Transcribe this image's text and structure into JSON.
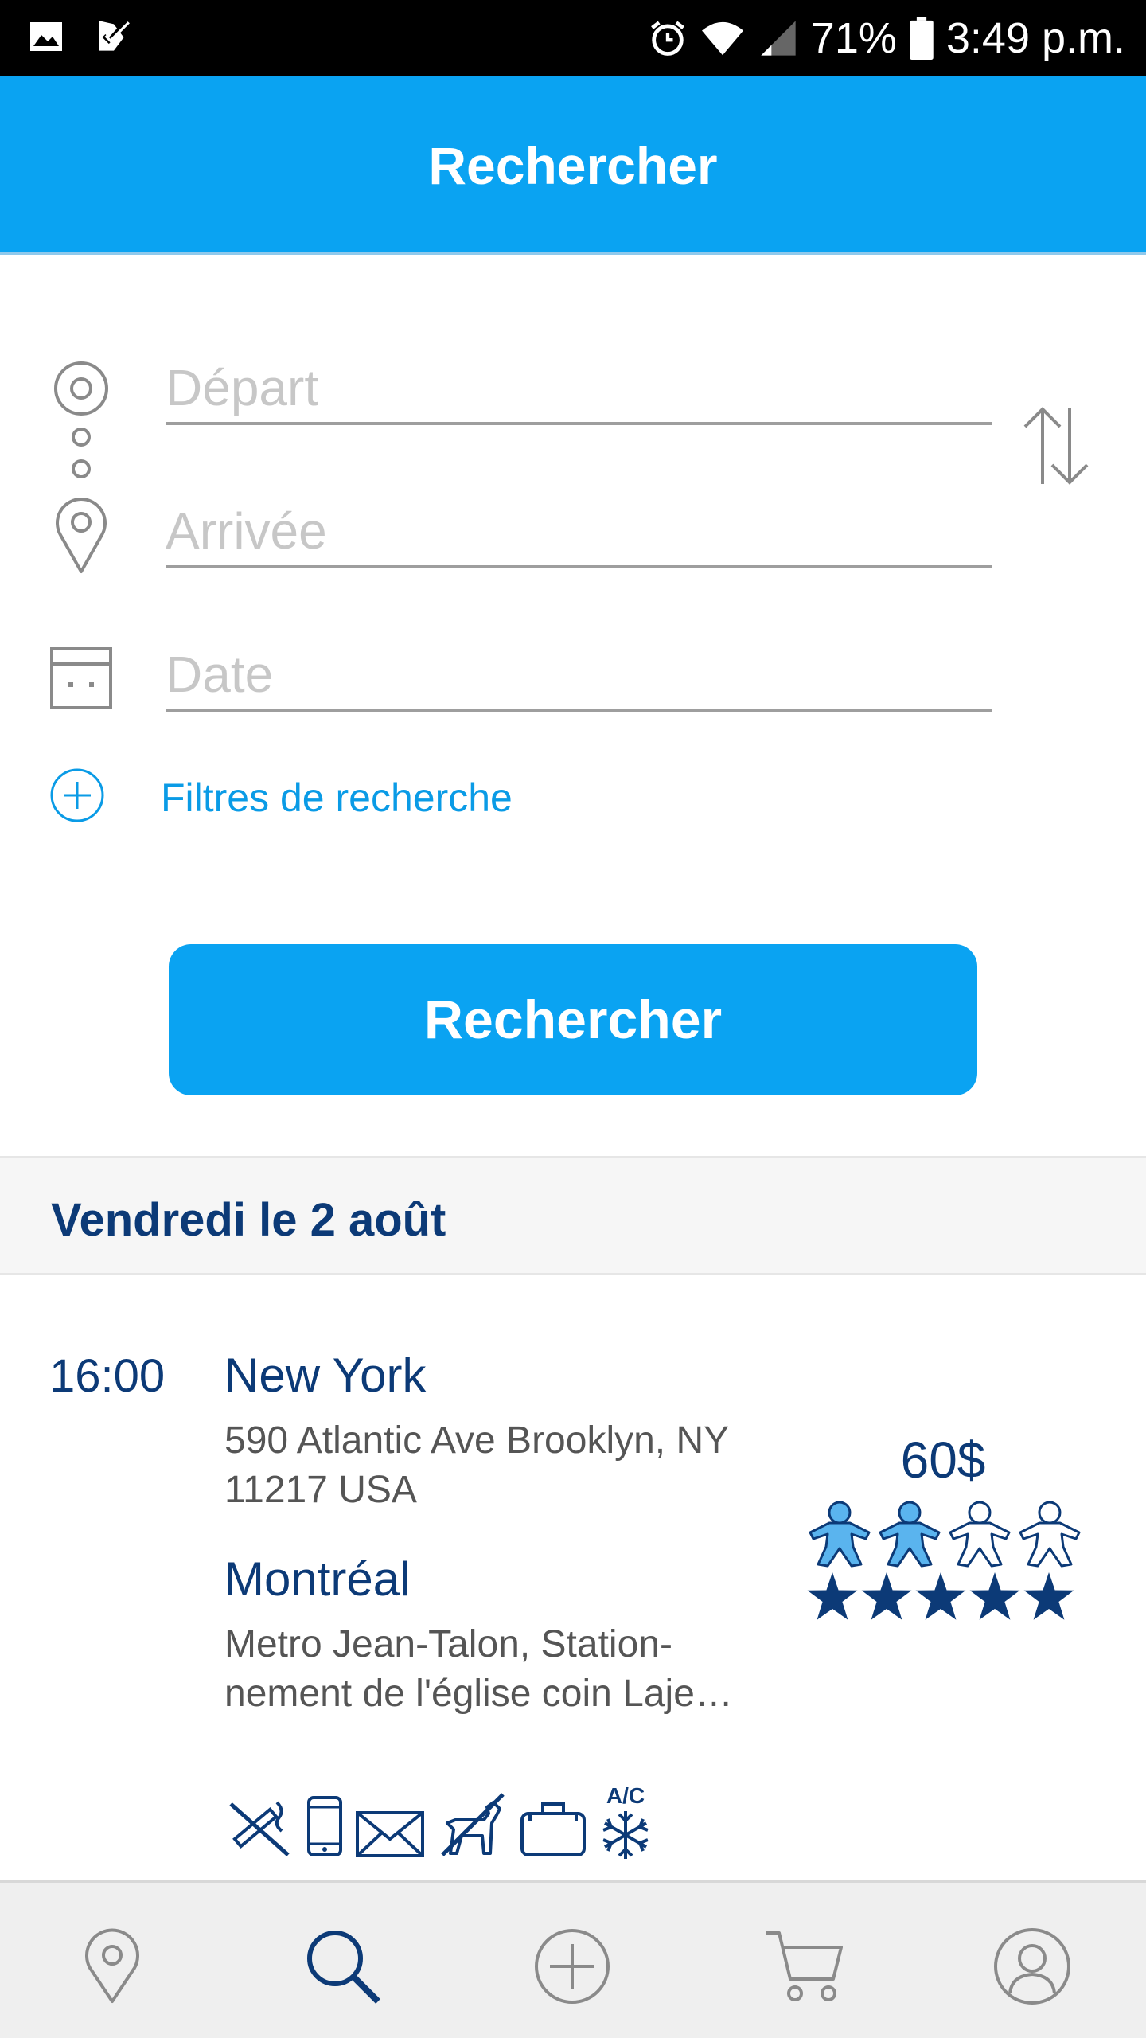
{
  "status_bar": {
    "battery_percent": "71%",
    "time": "3:49 p.m.",
    "left_icons": [
      "gallery-icon",
      "checkmark-notification-icon"
    ],
    "right_icons": [
      "alarm-icon",
      "wifi-icon",
      "signal-icon",
      "battery-icon"
    ]
  },
  "header": {
    "title": "Rechercher"
  },
  "form": {
    "departure_placeholder": "Départ",
    "arrival_placeholder": "Arrivée",
    "date_placeholder": "Date",
    "filters_label": "Filtres de recherche",
    "search_button_label": "Rechercher"
  },
  "results": {
    "date_header": "Vendredi le 2 août",
    "trips": [
      {
        "time": "16:00",
        "from_city": "New York",
        "from_address": "590 Atlantic Ave Brooklyn, NY 11217 USA",
        "to_city": "Montréal",
        "to_address": "Metro Jean-Talon, Station-nement de l'église coin Laje…",
        "price": "60$",
        "seats_total": 4,
        "seats_taken": 2,
        "rating_stars": 5,
        "ac_label": "A/C",
        "amenities": [
          "no-smoking-icon",
          "phone-icon",
          "mail-icon",
          "no-pets-icon",
          "luggage-icon",
          "air-conditioning-icon"
        ]
      }
    ]
  },
  "bottom_nav": {
    "items": [
      "map-pin-icon",
      "search-icon",
      "add-icon",
      "cart-icon",
      "profile-icon"
    ],
    "active": "search-icon"
  },
  "colors": {
    "accent": "#0aa3f2",
    "navy": "#0c3a77",
    "seat_filled": "#5ab4ee",
    "gray_icon": "#8a8a8a"
  }
}
